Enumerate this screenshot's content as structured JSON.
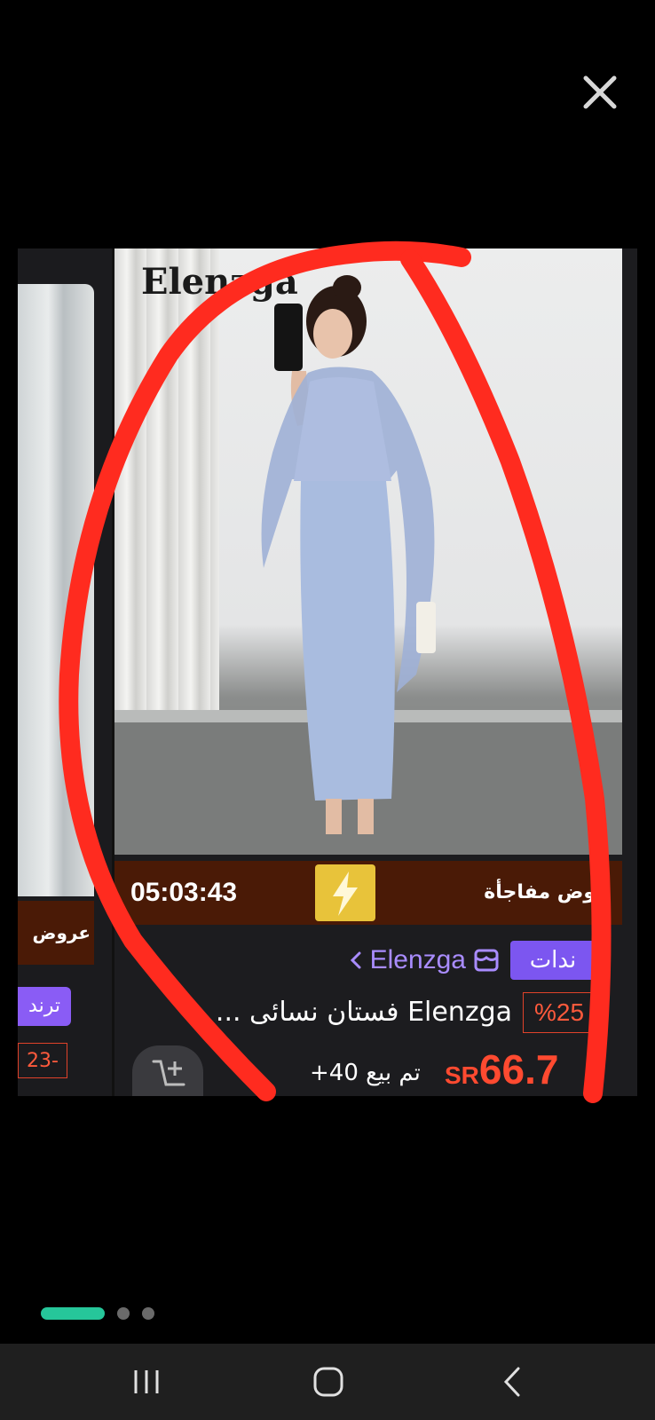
{
  "viewer": {
    "close_icon": "close-icon",
    "page_indicator": {
      "count": 3,
      "active_index": 0,
      "active_color": "#26c69a"
    }
  },
  "product_card": {
    "photo_watermark": "Elenzga",
    "flash_sale": {
      "countdown": "05:03:43",
      "label": "وض مفاجأة",
      "banner_color": "#4a1a06"
    },
    "trend_badge": "ندات",
    "store_name": "Elenzga",
    "discount": "%25",
    "title": "Elenzga فستان نسائى ...",
    "price_currency": "SR",
    "price_value": "66.7",
    "sold_text": "تم بيع 40+",
    "accent_color": "#ff4a30"
  },
  "neighbor_card": {
    "banner_text": "عروض",
    "trend_badge": "ترند",
    "discount": "23-"
  },
  "annotation": {
    "type": "hand-drawn circle",
    "color": "#ff2b1f"
  },
  "navigation_bar": {
    "recent_apps": "recent-apps-icon",
    "home": "home-icon",
    "back": "back-icon"
  }
}
